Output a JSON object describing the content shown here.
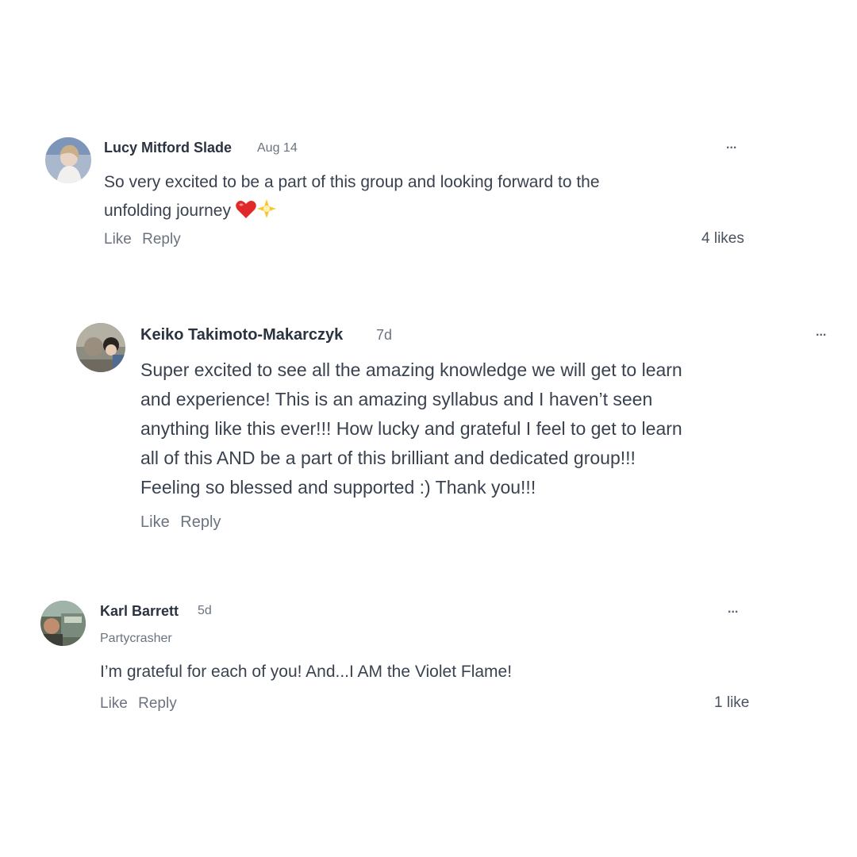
{
  "comments": [
    {
      "author": "Lucy Mitford Slade",
      "time": "Aug 14",
      "body_line1": "So very excited to be a part of this group and looking forward to the",
      "body_line2": "unfolding journey",
      "emojis": [
        "red-heart",
        "glowing-star"
      ],
      "like_label": "Like",
      "reply_label": "Reply",
      "likes": "4 likes",
      "more_label": "..."
    },
    {
      "author": "Keiko Takimoto-Makarczyk",
      "time": "7d",
      "body_lines": [
        "Super excited to see all the amazing knowledge we will get to learn",
        "and experience! This is an amazing syllabus and I haven’t seen",
        "anything like this ever!!! How lucky and grateful I feel to get to learn",
        "all of this AND be a part of this brilliant and dedicated group!!!",
        "Feeling so blessed and supported :) Thank you!!!"
      ],
      "like_label": "Like",
      "reply_label": "Reply",
      "more_label": "..."
    },
    {
      "author": "Karl Barrett",
      "time": "5d",
      "subtitle": "Partycrasher",
      "body": "I’m grateful for each of you! And...I AM the Violet Flame!",
      "like_label": "Like",
      "reply_label": "Reply",
      "likes": "1 like",
      "more_label": "..."
    }
  ]
}
